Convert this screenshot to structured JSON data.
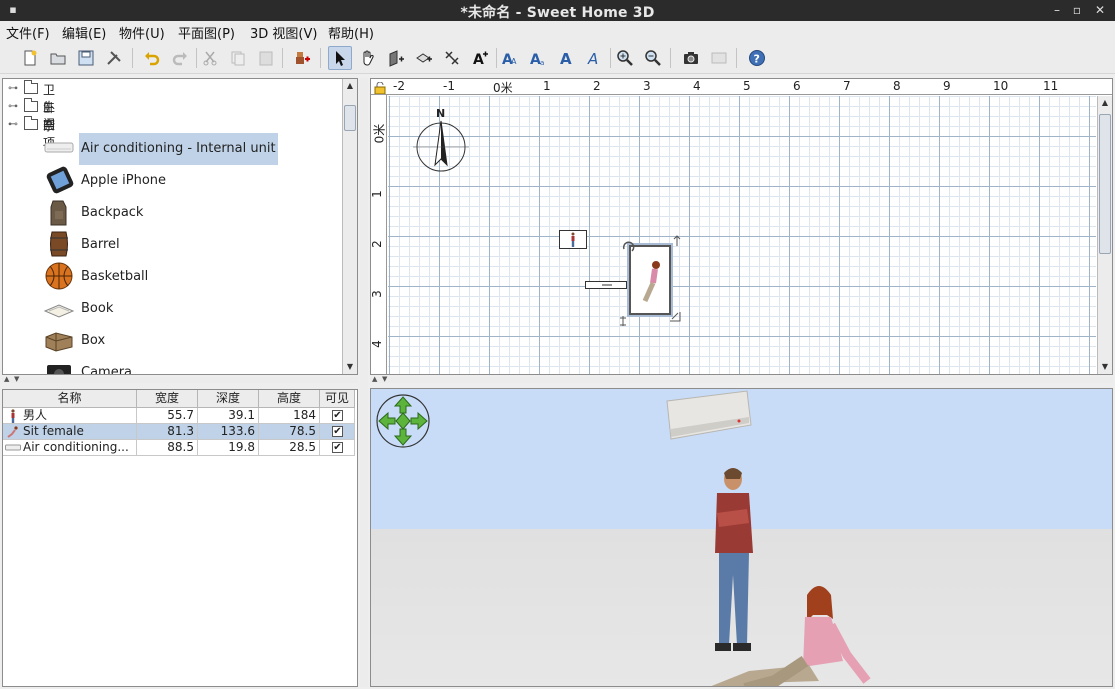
{
  "window": {
    "title": "*未命名 - Sweet Home 3D"
  },
  "menu": [
    "文件(F)",
    "编辑(E)",
    "物件(U)",
    "平面图(P)",
    "3D 视图(V)",
    "帮助(H)"
  ],
  "toolbar": {
    "buttons": [
      "new",
      "open",
      "save",
      "preferences",
      "undo",
      "redo",
      "cut",
      "copy",
      "paste",
      "add-furniture",
      "select-mode",
      "pan-mode",
      "create-walls",
      "create-rooms",
      "create-dimensions",
      "add-text",
      "text-style-1",
      "text-style-2",
      "bold",
      "italic",
      "zoom-in",
      "zoom-out",
      "create-photo",
      "create-video",
      "help"
    ],
    "selected": "select-mode"
  },
  "catalog": {
    "categories": [
      {
        "label": "卫生间",
        "expanded": false
      },
      {
        "label": "卧室",
        "expanded": false
      },
      {
        "label": "杂项",
        "expanded": true
      }
    ],
    "items": [
      {
        "label": "Air conditioning - Internal unit",
        "selected": true,
        "icon": "air-conditioner-icon"
      },
      {
        "label": "Apple iPhone",
        "selected": false,
        "icon": "iphone-icon"
      },
      {
        "label": "Backpack",
        "selected": false,
        "icon": "backpack-icon"
      },
      {
        "label": "Barrel",
        "selected": false,
        "icon": "barrel-icon"
      },
      {
        "label": "Basketball",
        "selected": false,
        "icon": "basketball-icon"
      },
      {
        "label": "Book",
        "selected": false,
        "icon": "book-icon"
      },
      {
        "label": "Box",
        "selected": false,
        "icon": "box-icon"
      },
      {
        "label": "Camera",
        "selected": false,
        "icon": "camera-icon"
      }
    ]
  },
  "furniture_table": {
    "columns": [
      "名称",
      "宽度",
      "深度",
      "高度",
      "可见"
    ],
    "rows": [
      {
        "name": "男人",
        "width": "55.7",
        "depth": "39.1",
        "height": "184",
        "visible": true,
        "selected": false
      },
      {
        "name": "Sit female",
        "width": "81.3",
        "depth": "133.6",
        "height": "78.5",
        "visible": true,
        "selected": true
      },
      {
        "name": "Air conditioning...",
        "width": "88.5",
        "depth": "19.8",
        "height": "28.5",
        "visible": true,
        "selected": false
      }
    ]
  },
  "plan": {
    "ruler_x_labels": [
      "-2",
      "-1",
      "0米",
      "1",
      "2",
      "3",
      "4",
      "5",
      "6",
      "7",
      "8",
      "9",
      "10",
      "11"
    ],
    "ruler_y_labels": [
      "0米",
      "1",
      "2",
      "3",
      "4"
    ],
    "compass_label": "N"
  },
  "colors": {
    "selection": "#bfd2e8",
    "sky": "#c8dcf8",
    "ground": "#e0e0e0",
    "grid_major": "#9fb3c9",
    "grid_minor": "#dde6ef"
  }
}
